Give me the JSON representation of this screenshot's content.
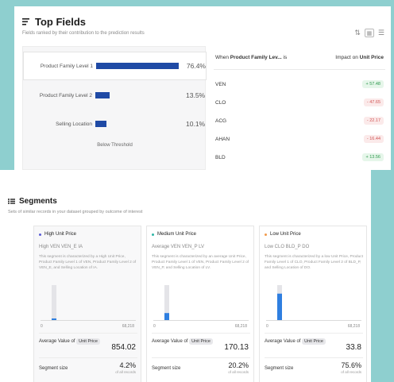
{
  "top_fields": {
    "title": "Top Fields",
    "subtitle": "Fields ranked by their contribution to the prediction results",
    "fields": [
      {
        "name": "Product Family Level 1",
        "pct": "76.4%",
        "value": 76.4,
        "selected": true
      },
      {
        "name": "Product Family Level 2",
        "pct": "13.5%",
        "value": 13.5,
        "selected": false
      },
      {
        "name": "Selling Location",
        "pct": "10.1%",
        "value": 10.1,
        "selected": false
      }
    ],
    "below_threshold": "Below Threshold",
    "impact": {
      "when_prefix": "When",
      "field": "Product Family Lev...",
      "is_label": "is",
      "impact_prefix": "Impact on",
      "target": "Unit Price",
      "rows": [
        {
          "category": "VEN",
          "value": "+ 57.48",
          "sign": "pos"
        },
        {
          "category": "CLO",
          "value": "- 47.65",
          "sign": "neg"
        },
        {
          "category": "ACG",
          "value": "- 22.17",
          "sign": "neg"
        },
        {
          "category": "AHAN",
          "value": "- 16.44",
          "sign": "neg"
        },
        {
          "category": "BLD",
          "value": "+ 13.56",
          "sign": "pos"
        }
      ]
    }
  },
  "segments": {
    "title": "Segments",
    "subtitle": "Sets of similar records in your dataset grouped by outcome of interest",
    "items": [
      {
        "name": "High Unit Price",
        "dot_color": "#5b5ed6",
        "avg_name": "High VEN VEN_E IA",
        "description": "This segment is characterized by a High Unit Price, Product Family Level 1 of VEN, Product Family Level 2 of VEN_E, and Selling Location of IA.",
        "axis_min": "0",
        "axis_max": "68,218",
        "bar_fraction": 0.04,
        "avg_label": "Average Value of",
        "avg_tag": "Unit Price",
        "avg_value": "854.02",
        "size_label": "Segment size",
        "size_value": "4.2%",
        "size_note": "of all records"
      },
      {
        "name": "Medium Unit Price",
        "dot_color": "#2fb6a6",
        "avg_name": "Average VEN VEN_P LV",
        "description": "This segment is characterized by an average Unit Price, Product Family Level 1 of VEN, Product Family Level 2 of VEN_P, and Selling Location of LV.",
        "axis_min": "0",
        "axis_max": "68,218",
        "bar_fraction": 0.2,
        "avg_label": "Average Value of",
        "avg_tag": "Unit Price",
        "avg_value": "170.13",
        "size_label": "Segment size",
        "size_value": "20.2%",
        "size_note": "of all records"
      },
      {
        "name": "Low Unit Price",
        "dot_color": "#f29a4a",
        "avg_name": "Low CLO BLD_P DO",
        "description": "This segment is characterized by a low Unit Price, Product Family Level 1 of CLO, Product Family Level 2 of BLD_P, and Selling Location of DO.",
        "axis_min": "0",
        "axis_max": "68,218",
        "bar_fraction": 0.756,
        "avg_label": "Average Value of",
        "avg_tag": "Unit Price",
        "avg_value": "33.8",
        "size_label": "Segment size",
        "size_value": "75.6%",
        "size_note": "of all records"
      }
    ]
  },
  "colors": {
    "bar_blue": "#1f4aa5",
    "hist_blue": "#2f7fe0",
    "hist_grey": "#e4e4e8",
    "positive": "#2f9a4e",
    "negative": "#d15454"
  }
}
